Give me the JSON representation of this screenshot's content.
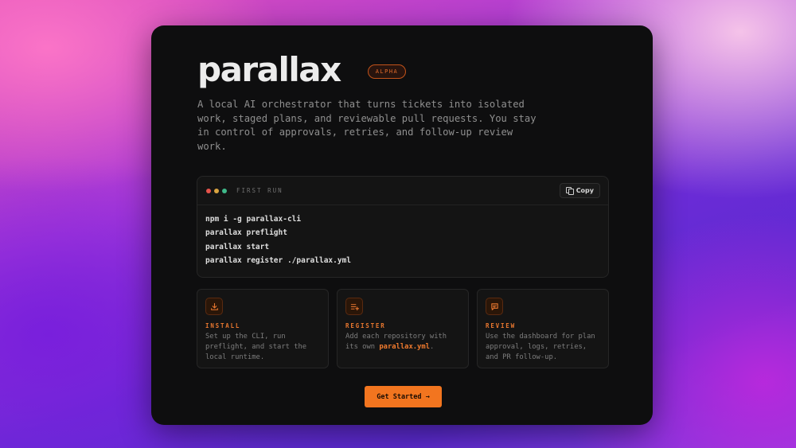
{
  "header": {
    "title": "parallax",
    "badge": "ALPHA",
    "description": "A local AI orchestrator that turns tickets into isolated work, staged plans, and reviewable pull requests. You stay in control of approvals, retries, and follow-up review work."
  },
  "terminal": {
    "label": "FIRST RUN",
    "copy_label": "Copy",
    "dot_colors": [
      "#e5534b",
      "#d9a441",
      "#3fb98a"
    ],
    "commands": [
      "npm i -g parallax-cli",
      "parallax preflight",
      "parallax start",
      "parallax register ./parallax.yml"
    ]
  },
  "cards": [
    {
      "icon": "download-icon",
      "title": "INSTALL",
      "text": "Set up the CLI, run preflight, and start the local runtime."
    },
    {
      "icon": "list-plus-icon",
      "title": "REGISTER",
      "text_before": "Add each repository with its own ",
      "text_highlight": "parallax.yml",
      "text_after": "."
    },
    {
      "icon": "message-square-icon",
      "title": "REVIEW",
      "text": "Use the dashboard for plan approval, logs, retries, and PR follow-up."
    }
  ],
  "cta": {
    "label": "Get Started →"
  },
  "colors": {
    "accent": "#f2751f",
    "panel": "#0e0e0f"
  }
}
